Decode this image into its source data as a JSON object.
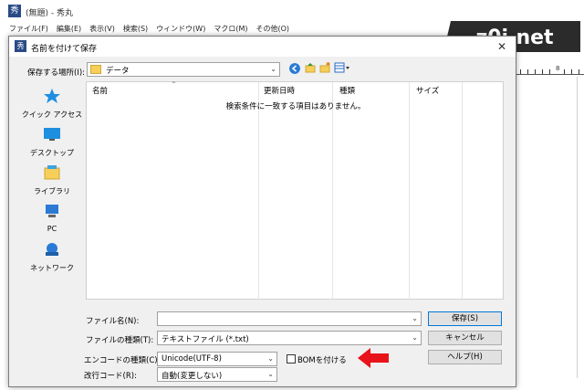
{
  "app": {
    "title": "(無題) - 秀丸",
    "icon_text": "秀",
    "menu": [
      "ファイル(F)",
      "編集(E)",
      "表示(V)",
      "検索(S)",
      "ウィンドウ(W)",
      "マクロ(M)",
      "その他(O)"
    ],
    "watermark": "z0i.net",
    "ruler_mark": "8"
  },
  "dialog": {
    "title": "名前を付けて保存",
    "location_label": "保存する場所(I):",
    "location_value": "データ",
    "places": [
      {
        "label": "クイック アクセス",
        "icon": "star-icon"
      },
      {
        "label": "デスクトップ",
        "icon": "desktop-icon"
      },
      {
        "label": "ライブラリ",
        "icon": "library-icon"
      },
      {
        "label": "PC",
        "icon": "computer-icon"
      },
      {
        "label": "ネットワーク",
        "icon": "network-icon"
      }
    ],
    "columns": [
      "名前",
      "更新日時",
      "種類",
      "サイズ"
    ],
    "empty_message": "検索条件に一致する項目はありません。",
    "filename_label": "ファイル名(N):",
    "filename_value": "",
    "filetype_label": "ファイルの種類(T):",
    "filetype_value": "テキストファイル (*.txt)",
    "encoding_label": "エンコードの種類(C):",
    "encoding_value": "Unicode(UTF-8)",
    "bom_label": "BOMを付ける",
    "bom_checked": false,
    "newline_label": "改行コード(R):",
    "newline_value": "自動(変更しない)",
    "save_button": "保存(S)",
    "cancel_button": "キャンセル",
    "help_button": "ヘルプ(H)"
  },
  "colors": {
    "accent": "#0078d7",
    "arrow": "#e8131b",
    "watermark_bg": "#2b2b2b"
  }
}
